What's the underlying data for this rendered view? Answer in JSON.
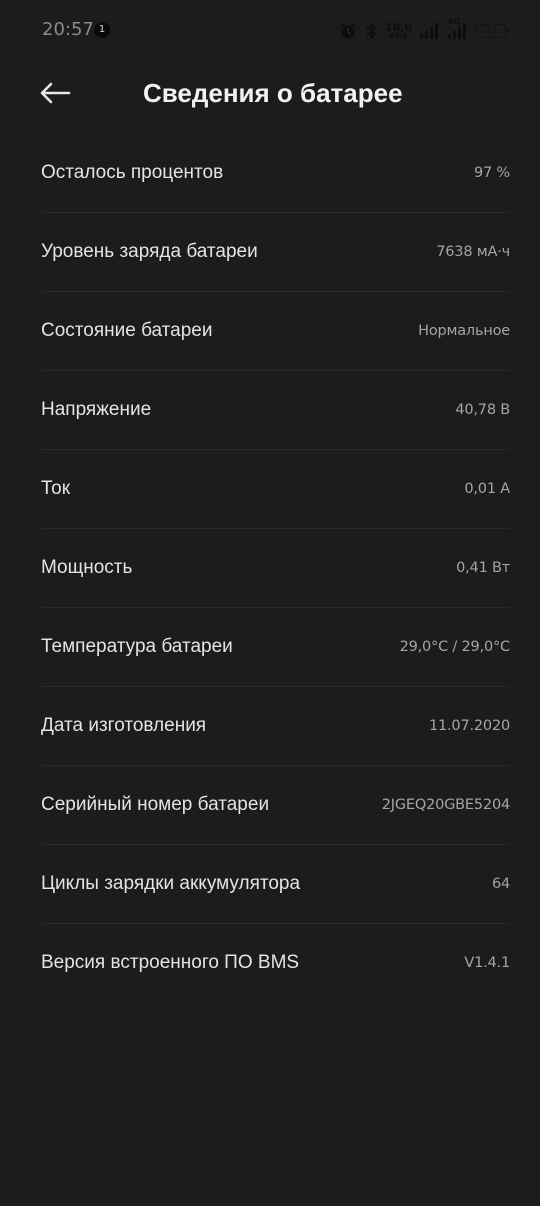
{
  "status_bar": {
    "time": "20:57",
    "notification_count": "1",
    "net_speed_value": "10,0",
    "net_speed_unit": "KB/S",
    "network_type": "4G",
    "battery_level": "73"
  },
  "header": {
    "title": "Сведения о батарее"
  },
  "battery_info": [
    {
      "label": "Осталось процентов",
      "value": "97 %"
    },
    {
      "label": "Уровень заряда батареи",
      "value": "7638 мА·ч"
    },
    {
      "label": "Состояние батареи",
      "value": "Нормальное"
    },
    {
      "label": "Напряжение",
      "value": "40,78 В"
    },
    {
      "label": "Ток",
      "value": "0,01 А"
    },
    {
      "label": "Мощность",
      "value": "0,41 Вт"
    },
    {
      "label": "Температура батареи",
      "value": "29,0°C / 29,0°C"
    },
    {
      "label": "Дата изготовления",
      "value": "11.07.2020"
    },
    {
      "label": "Серийный номер батареи",
      "value": "2JGEQ20GBE5204"
    },
    {
      "label": "Циклы зарядки аккумулятора",
      "value": "64"
    },
    {
      "label": "Версия встроенного ПО BMS",
      "value": "V1.4.1"
    }
  ],
  "colors": {
    "background": "#1c1c1c",
    "text_primary": "#e4e4e4",
    "text_secondary": "#a5a5a5",
    "divider": "#292929"
  },
  "icons": {
    "back": "arrow-left-icon",
    "alarm": "alarm-icon",
    "bluetooth": "bluetooth-icon",
    "signal": "signal-icon",
    "battery": "battery-icon"
  }
}
